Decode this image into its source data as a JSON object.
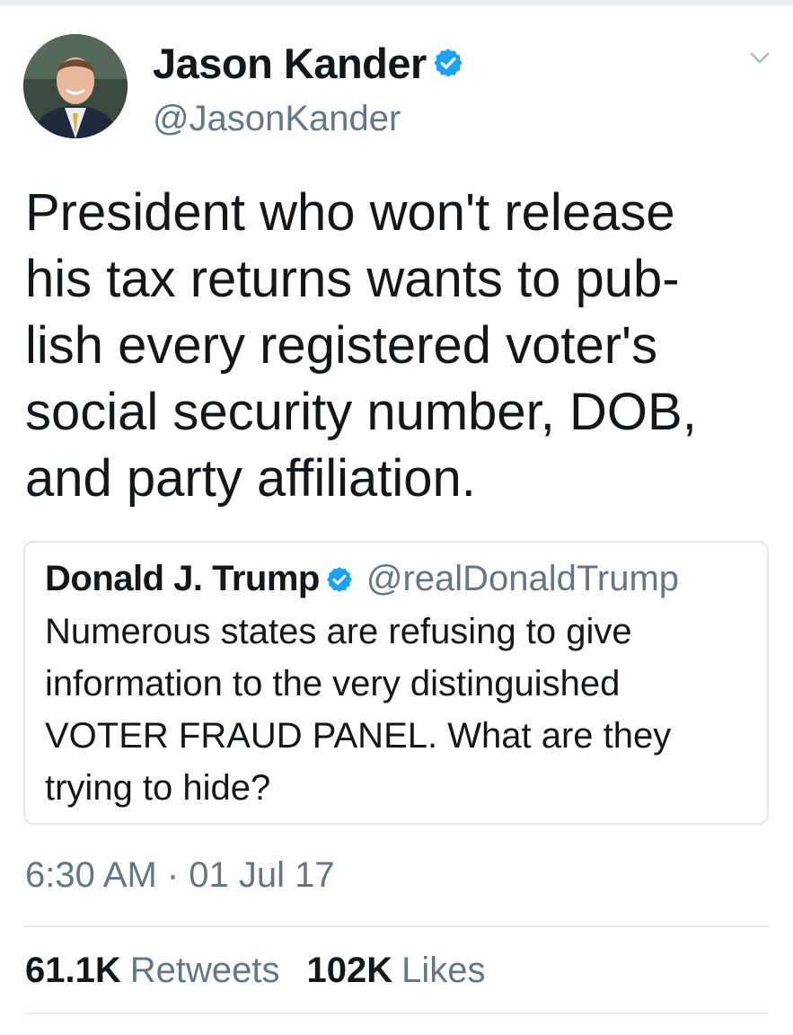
{
  "tweet": {
    "author": {
      "display_name": "Jason Kander",
      "handle": "@JasonKander",
      "verified": true
    },
    "text": "President who won't release\nhis tax returns wants to pub-\nlish every registered voter's\nsocial security number, DOB,\nand party affiliation.",
    "quoted_tweet": {
      "display_name": "Donald J. Trump",
      "handle": "@realDonaldTrump",
      "verified": true,
      "text": "Numerous states are refusing to give\ninformation to the very distinguished\nVOTER FRAUD PANEL. What are they\ntrying to hide?"
    },
    "timestamp": "6:30 AM · 01 Jul 17",
    "stats": {
      "retweets_count": "61.1K",
      "retweets_label": "Retweets",
      "likes_count": "102K",
      "likes_label": "Likes"
    }
  },
  "icons": {
    "verified": "verified-badge-icon",
    "caret": "chevron-down-icon"
  },
  "colors": {
    "verified_blue": "#1da1f2",
    "text_primary": "#14171a",
    "text_secondary": "#657786",
    "border": "#e1e8ed"
  }
}
